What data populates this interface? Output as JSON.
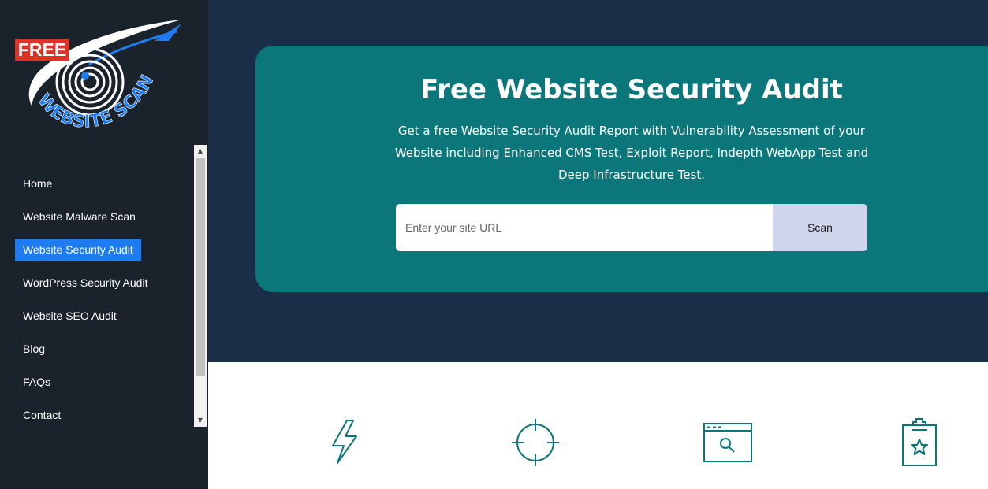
{
  "logo": {
    "badge": "FREE",
    "text": "WEBSITE SCAN"
  },
  "colors": {
    "accent": "#1f7cf0",
    "teal": "#0c777a",
    "navy": "#1b2e47",
    "sidebar": "#1a222c"
  },
  "nav": {
    "items": [
      {
        "label": "Home"
      },
      {
        "label": "Website Malware Scan"
      },
      {
        "label": "Website Security Audit",
        "active": true
      },
      {
        "label": "WordPress Security Audit"
      },
      {
        "label": "Website SEO Audit"
      },
      {
        "label": "Blog"
      },
      {
        "label": "FAQs"
      },
      {
        "label": "Contact"
      }
    ]
  },
  "hero": {
    "title": "Free Website Security Audit",
    "description": "Get a free Website Security Audit Report with Vulnerability Assessment of your Website including Enhanced CMS Test, Exploit Report, Indepth WebApp Test and Deep Infrastructure Test.",
    "search": {
      "placeholder": "Enter your site URL",
      "value": "",
      "button": "Scan"
    }
  },
  "features": [
    {
      "icon": "lightning-icon"
    },
    {
      "icon": "crosshair-icon"
    },
    {
      "icon": "browser-search-icon"
    },
    {
      "icon": "clipboard-star-icon"
    }
  ]
}
